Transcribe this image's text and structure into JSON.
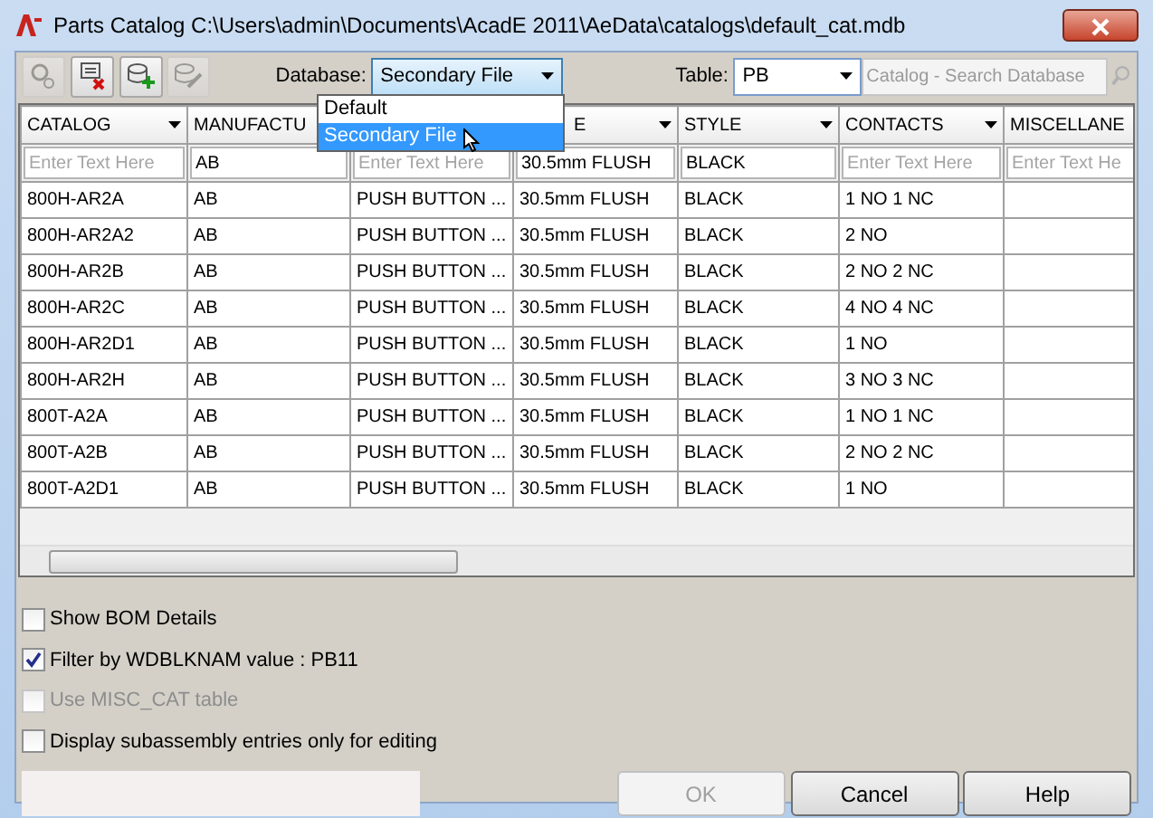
{
  "window": {
    "title": "Parts Catalog C:\\Users\\admin\\Documents\\AcadE 2011\\AeData\\catalogs\\default_cat.mdb"
  },
  "toolbar": {
    "buttons": [
      {
        "kind": "find",
        "disabled": true
      },
      {
        "kind": "remove",
        "disabled": false
      },
      {
        "kind": "add",
        "disabled": false
      },
      {
        "kind": "edit",
        "disabled": true
      }
    ],
    "database": {
      "label": "Database:",
      "value": "Secondary File",
      "expanded": true,
      "options": [
        {
          "label": "Default",
          "selected": false
        },
        {
          "label": "Secondary File",
          "selected": true
        }
      ]
    },
    "table": {
      "label": "Table:",
      "value": "PB"
    },
    "search": {
      "placeholder": "Catalog - Search Database",
      "disabled": true
    }
  },
  "grid": {
    "columns": [
      {
        "label": "CATALOG",
        "menu": true
      },
      {
        "label": "MANUFACTU"
      },
      {},
      {
        "label": "E",
        "menu": true
      },
      {
        "label": "STYLE",
        "menu": true
      },
      {
        "label": "CONTACTS",
        "menu": true
      },
      {
        "label": "MISCELLANE"
      }
    ],
    "filters": [
      {
        "placeholder": "Enter Text Here"
      },
      {
        "value": "AB"
      },
      {
        "placeholder": "Enter Text Here"
      },
      {
        "value": "30.5mm FLUSH"
      },
      {
        "value": "BLACK"
      },
      {
        "placeholder": "Enter Text Here"
      },
      {
        "placeholder": "Enter Text He"
      }
    ],
    "rows": [
      [
        "800H-AR2A",
        "AB",
        "PUSH BUTTON ...",
        "30.5mm FLUSH",
        "BLACK",
        "1 NO 1 NC"
      ],
      [
        "800H-AR2A2",
        "AB",
        "PUSH BUTTON ...",
        "30.5mm FLUSH",
        "BLACK",
        "2 NO"
      ],
      [
        "800H-AR2B",
        "AB",
        "PUSH BUTTON ...",
        "30.5mm FLUSH",
        "BLACK",
        "2 NO 2 NC"
      ],
      [
        "800H-AR2C",
        "AB",
        "PUSH BUTTON ...",
        "30.5mm FLUSH",
        "BLACK",
        "4 NO 4 NC"
      ],
      [
        "800H-AR2D1",
        "AB",
        "PUSH BUTTON ...",
        "30.5mm FLUSH",
        "BLACK",
        "1 NO"
      ],
      [
        "800H-AR2H",
        "AB",
        "PUSH BUTTON ...",
        "30.5mm FLUSH",
        "BLACK",
        "3 NO 3 NC"
      ],
      [
        "800T-A2A",
        "AB",
        "PUSH BUTTON ...",
        "30.5mm FLUSH",
        "BLACK",
        "1 NO 1 NC"
      ],
      [
        "800T-A2B",
        "AB",
        "PUSH BUTTON ...",
        "30.5mm FLUSH",
        "BLACK",
        "2 NO 2 NC"
      ],
      [
        "800T-A2D1",
        "AB",
        "PUSH BUTTON ...",
        "30.5mm FLUSH",
        "BLACK",
        "1 NO"
      ]
    ]
  },
  "options": [
    {
      "label": "Show BOM Details",
      "checked": false,
      "disabled": false
    },
    {
      "label": "Filter by WDBLKNAM value : PB11",
      "checked": true,
      "disabled": false
    },
    {
      "label": "Use MISC_CAT table",
      "checked": false,
      "disabled": true
    },
    {
      "label": "Display subassembly entries only for editing",
      "checked": false,
      "disabled": false
    }
  ],
  "buttons": [
    {
      "label": "OK",
      "disabled": true
    },
    {
      "label": "Cancel",
      "disabled": false
    },
    {
      "label": "Help",
      "disabled": false
    }
  ]
}
